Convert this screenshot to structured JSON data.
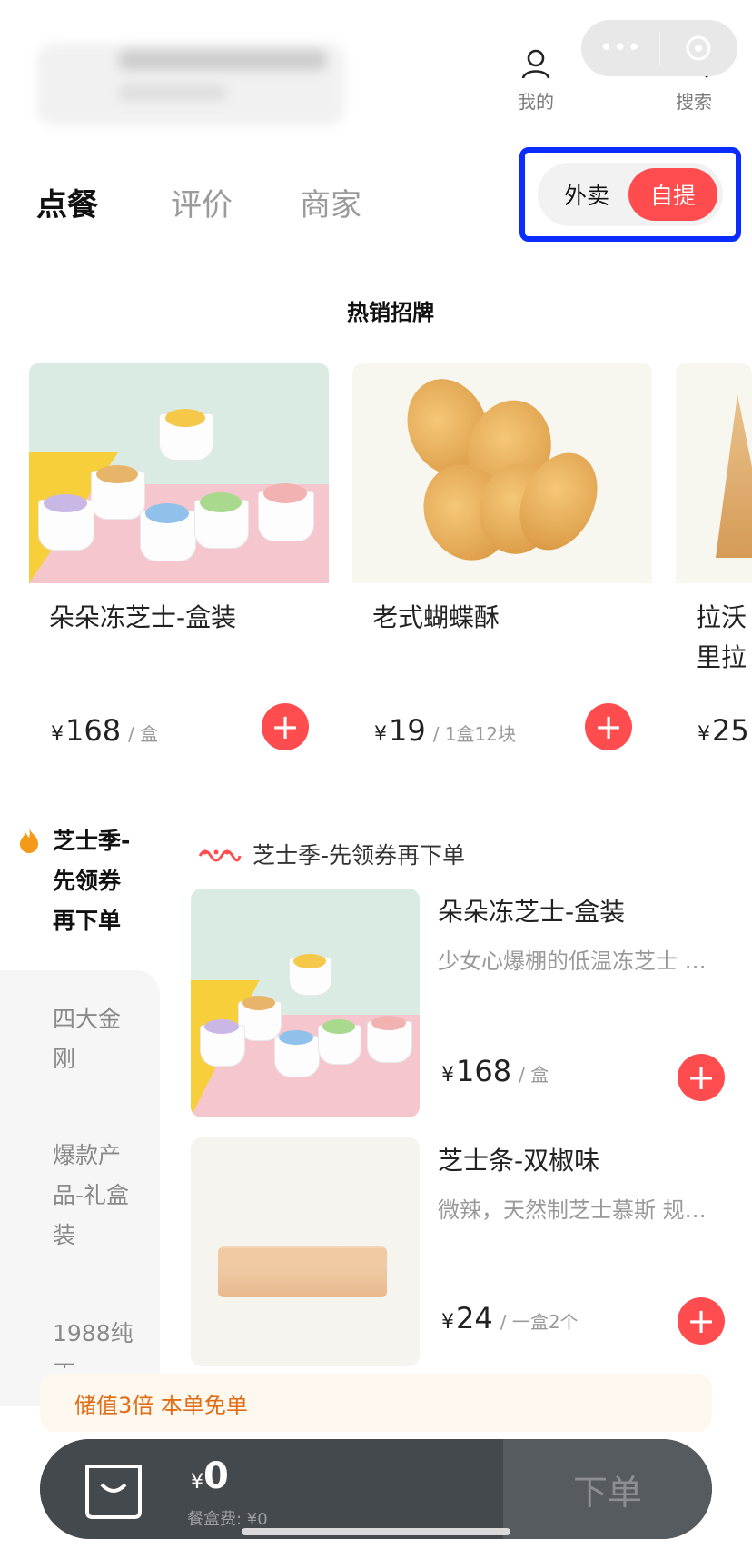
{
  "header": {
    "menu_icon": "more-dots-icon",
    "target_icon": "target-icon",
    "profile_label": "我的",
    "search_label": "搜索"
  },
  "tabs": [
    "点餐",
    "评价",
    "商家"
  ],
  "mode_toggle": {
    "delivery": "外卖",
    "pickup": "自提",
    "selected": "自提"
  },
  "hot_section": {
    "title": "热销招牌",
    "items": [
      {
        "name": "朵朵冻芝士-盒装",
        "currency": "¥",
        "price": "168",
        "unit": "/ 盒"
      },
      {
        "name": "老式蝴蝶酥",
        "currency": "¥",
        "price": "19",
        "unit": "/ 1盒12块"
      },
      {
        "name": "拉沃",
        "name_line2": "里拉",
        "currency": "¥",
        "price": "25",
        "unit": ""
      }
    ]
  },
  "sidebar": {
    "items": [
      {
        "label": [
          "芝士季-",
          "先领券",
          "再下单"
        ],
        "active": true
      },
      {
        "label": [
          "四大金",
          "刚"
        ],
        "active": false
      },
      {
        "label": [
          "爆款产",
          "品-礼盒",
          "装"
        ],
        "active": false
      },
      {
        "label": [
          "1988纯",
          "正"
        ],
        "active": false
      }
    ]
  },
  "category": {
    "title": "芝士季-先领券再下单"
  },
  "products": [
    {
      "name": "朵朵冻芝士-盒装",
      "desc": "少女心爆棚的低温冻芝士 …",
      "currency": "¥",
      "price": "168",
      "unit": "/ 盒"
    },
    {
      "name": "芝士条-双椒味",
      "desc": "微辣，天然制芝士慕斯 规…",
      "currency": "¥",
      "price": "24",
      "unit": "/ 一盒2个"
    }
  ],
  "promo": {
    "text": "储值3倍 本单免单"
  },
  "cart": {
    "currency": "¥",
    "total": "0",
    "fee_label": "餐盒费: ¥0",
    "order_label": "下单"
  },
  "colors": {
    "accent": "#ff4d4f",
    "highlight_box": "#0a2cff",
    "promo_text": "#e06d15"
  }
}
